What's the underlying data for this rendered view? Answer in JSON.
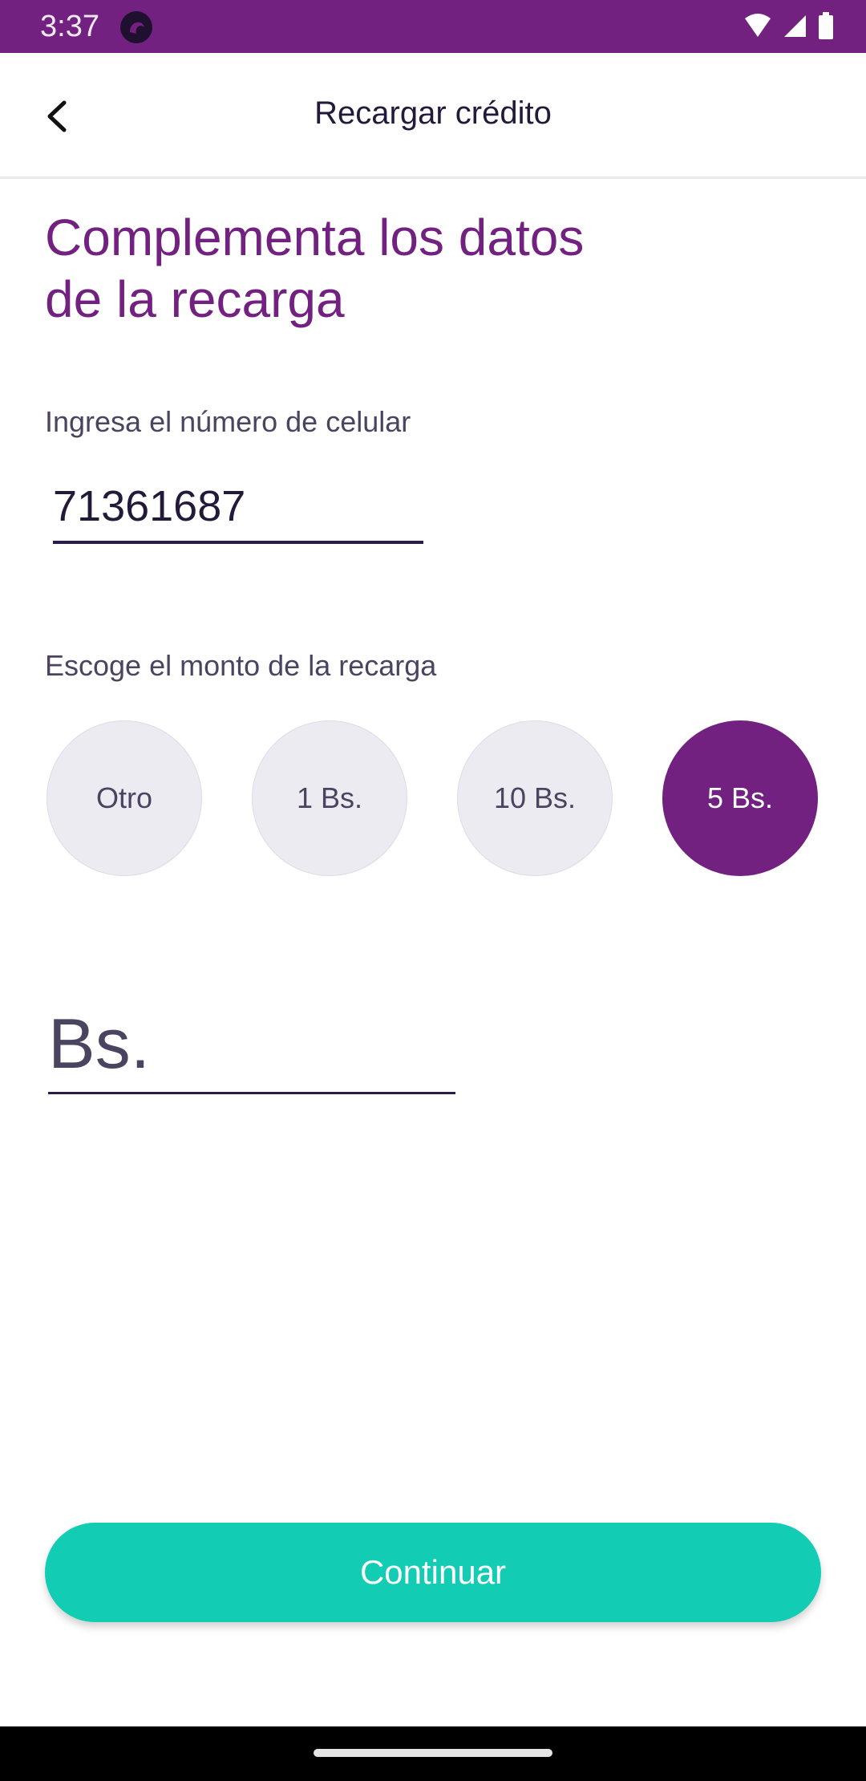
{
  "status_bar": {
    "time": "3:37",
    "icons": [
      "app-notification-icon",
      "wifi-icon",
      "signal-icon",
      "battery-icon"
    ],
    "background_color": "#722181"
  },
  "app_bar": {
    "title": "Recargar crédito",
    "back_icon": "chevron-left-icon"
  },
  "main": {
    "heading": "Complementa los datos de la recarga",
    "phone_label": "Ingresa el número de celular",
    "phone_value": "71361687",
    "amount_label": "Escoge el monto de la recarga",
    "amount_options": [
      {
        "label": "Otro",
        "selected": false
      },
      {
        "label": "1 Bs.",
        "selected": false
      },
      {
        "label": "10 Bs.",
        "selected": false
      },
      {
        "label": "5 Bs.",
        "selected": true
      }
    ],
    "custom_amount_placeholder": "Bs.",
    "continue_label": "Continuar"
  },
  "colors": {
    "accent": "#722181",
    "button": "#12ccb4",
    "text_dark": "#231a3a",
    "text_muted": "#4b4460"
  }
}
